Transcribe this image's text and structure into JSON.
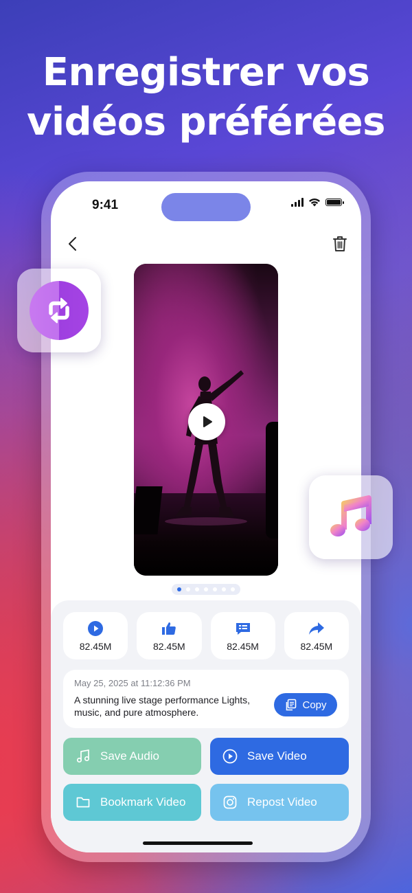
{
  "headline": {
    "line1": "Enregistrer vos",
    "line2": "vidéos préférées"
  },
  "status_bar": {
    "time": "9:41",
    "icons": [
      "cellular-signal-icon",
      "wifi-icon",
      "battery-icon"
    ]
  },
  "nav": {
    "back_icon": "chevron-left-icon",
    "delete_icon": "trash-icon"
  },
  "video": {
    "play_icon": "play-icon",
    "page_count": 7,
    "current_page": 1
  },
  "stats": [
    {
      "icon": "play-circle-icon",
      "value": "82.45M"
    },
    {
      "icon": "thumbs-up-icon",
      "value": "82.45M"
    },
    {
      "icon": "comment-icon",
      "value": "82.45M"
    },
    {
      "icon": "share-arrow-icon",
      "value": "82.45M"
    }
  ],
  "info": {
    "date": "May 25, 2025 at 11:12:36 PM",
    "description": "A stunning live stage performance Lights, music, and pure atmosphere.",
    "copy_label": "Copy"
  },
  "actions": {
    "save_audio": "Save Audio",
    "save_video": "Save Video",
    "bookmark_video": "Bookmark Video",
    "repost_video": "Repost Video"
  },
  "colors": {
    "accent": "#2e6ae2",
    "save_audio": "#85ceb0",
    "bookmark": "#5ec8d4",
    "repost": "#76c3ee",
    "island": "#7b85e8"
  },
  "badges": [
    "repost-app-icon",
    "music-note-icon"
  ]
}
